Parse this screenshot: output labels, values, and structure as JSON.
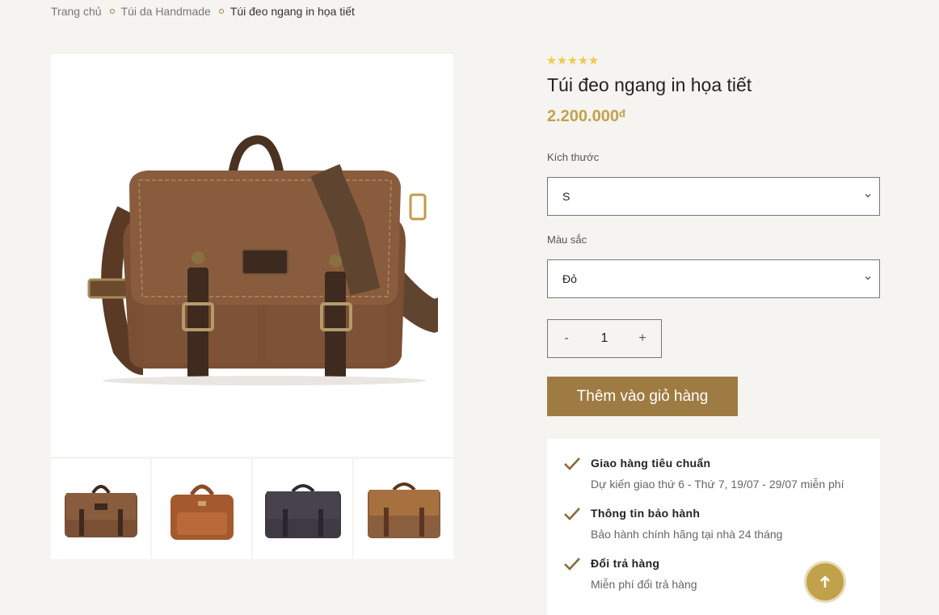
{
  "breadcrumb": {
    "home": "Trang chủ",
    "category": "Túi da Handmade",
    "current": "Túi đeo ngang in họa tiết"
  },
  "gallery": {
    "main_image": "brown-canvas-messenger-bag",
    "thumbnails": [
      "brown-canvas-messenger-bag",
      "tan-leather-briefcase",
      "dark-leather-messenger-bag",
      "brown-leather-messenger-bag"
    ]
  },
  "product": {
    "rating": 5,
    "title": "Túi đeo ngang in họa tiết",
    "price": "2.200.000",
    "currency": "đ"
  },
  "options": {
    "size_label": "Kích thước",
    "size_value": "S",
    "color_label": "Màu sắc",
    "color_value": "Đỏ"
  },
  "quantity": {
    "minus": "-",
    "value": "1",
    "plus": "+"
  },
  "add_to_cart_label": "Thêm vào giỏ hàng",
  "info": [
    {
      "title": "Giao hàng tiêu chuẩn",
      "desc": "Dự kiến giao thứ 6 - Thứ 7, 19/07 - 29/07 miễn phí"
    },
    {
      "title": "Thông tin bảo hành",
      "desc": "Bảo hành chính hãng tại nhà 24 tháng"
    },
    {
      "title": "Đổi trả hàng",
      "desc": "Miễn phí đổi trả hàng"
    }
  ],
  "colors": {
    "accent": "#9e7b42",
    "price": "#c2a24a",
    "star": "#f2c94c",
    "background": "#f6f4f1"
  }
}
